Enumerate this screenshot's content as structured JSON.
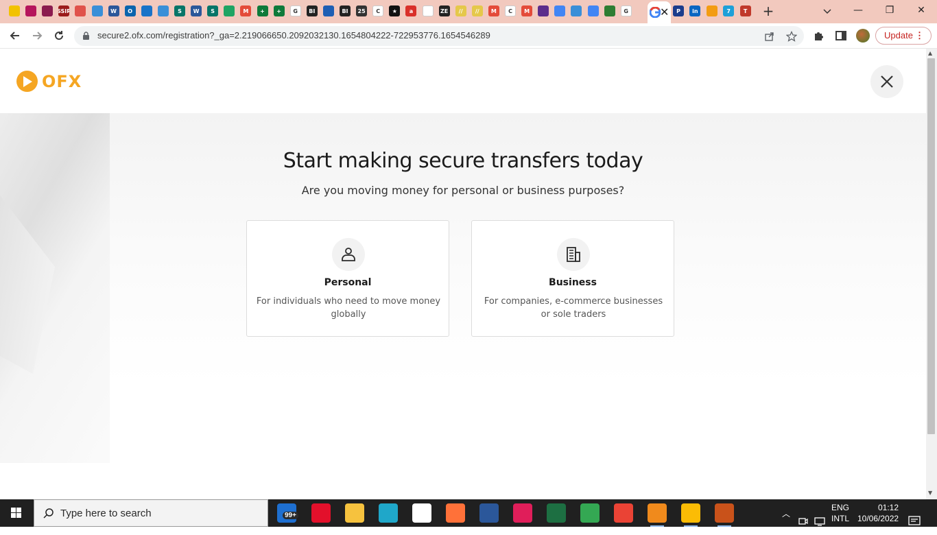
{
  "browser": {
    "tabs": [
      {
        "icon": "yellow-circle-icon",
        "color": "#f2c200",
        "glyph": ""
      },
      {
        "icon": "pink-bolt-icon",
        "color": "#b5155c",
        "glyph": ""
      },
      {
        "icon": "pink-bolt-icon",
        "color": "#8b1c4f",
        "glyph": ""
      },
      {
        "icon": "ssir-icon",
        "color": "#9b1b1b",
        "glyph": "SSIR"
      },
      {
        "icon": "colorful-circle-icon",
        "color": "#e0524b",
        "glyph": ""
      },
      {
        "icon": "chrome-blue-icon",
        "color": "#3a8fd8",
        "glyph": ""
      },
      {
        "icon": "word-icon",
        "color": "#2b579a",
        "glyph": "W"
      },
      {
        "icon": "outlook-icon",
        "color": "#0a64ad",
        "glyph": "O"
      },
      {
        "icon": "onedrive-icon",
        "color": "#1a73c8",
        "glyph": ""
      },
      {
        "icon": "chrome-blue-icon",
        "color": "#3a8fd8",
        "glyph": ""
      },
      {
        "icon": "sway-icon",
        "color": "#077568",
        "glyph": "S"
      },
      {
        "icon": "word-icon",
        "color": "#2b579a",
        "glyph": "W"
      },
      {
        "icon": "sway-icon",
        "color": "#077568",
        "glyph": "S"
      },
      {
        "icon": "drive-icon",
        "color": "#1fa463",
        "glyph": ""
      },
      {
        "icon": "gmail-icon",
        "color": "#e44b3a",
        "glyph": "M"
      },
      {
        "icon": "plus-green-icon",
        "color": "#0e7a3a",
        "glyph": "+"
      },
      {
        "icon": "plus-green-icon",
        "color": "#0e7a3a",
        "glyph": "+"
      },
      {
        "icon": "google-icon",
        "color": "#ffffff",
        "glyph": "G"
      },
      {
        "icon": "bi-icon",
        "color": "#222222",
        "glyph": "BI"
      },
      {
        "icon": "blue-wave-icon",
        "color": "#1e5fb4",
        "glyph": ""
      },
      {
        "icon": "bi-icon",
        "color": "#222222",
        "glyph": "BI"
      },
      {
        "icon": "25-icon",
        "color": "#333333",
        "glyph": "25"
      },
      {
        "icon": "c-icon",
        "color": "#ffffff",
        "glyph": "C"
      },
      {
        "icon": "star-icon",
        "color": "#111111",
        "glyph": "★"
      },
      {
        "icon": "red-a-icon",
        "color": "#d9302a",
        "glyph": "a"
      },
      {
        "icon": "hand-icon",
        "color": "#ffffff",
        "glyph": ""
      },
      {
        "icon": "zen-icon",
        "color": "#222222",
        "glyph": "ZE"
      },
      {
        "icon": "yellow-slash-icon",
        "color": "#e5c84a",
        "glyph": "//"
      },
      {
        "icon": "yellow-slash-icon",
        "color": "#e5c84a",
        "glyph": "//"
      },
      {
        "icon": "gmail-icon",
        "color": "#e44b3a",
        "glyph": "M"
      },
      {
        "icon": "c-icon",
        "color": "#ffffff",
        "glyph": "C"
      },
      {
        "icon": "gmail-icon",
        "color": "#e44b3a",
        "glyph": "M"
      },
      {
        "icon": "trello-icon",
        "color": "#5b2d8c",
        "glyph": ""
      },
      {
        "icon": "docs-icon",
        "color": "#4285f4",
        "glyph": ""
      },
      {
        "icon": "chrome-blue-icon",
        "color": "#3a8fd8",
        "glyph": ""
      },
      {
        "icon": "docs-icon",
        "color": "#4285f4",
        "glyph": ""
      },
      {
        "icon": "qr-icon",
        "color": "#2e7d32",
        "glyph": ""
      },
      {
        "icon": "google-icon",
        "color": "#ffffff",
        "glyph": "G"
      }
    ],
    "tabs_after": [
      {
        "icon": "paypal-icon",
        "color": "#1b3c8c",
        "glyph": "P"
      },
      {
        "icon": "linkedin-icon",
        "color": "#0a66c2",
        "glyph": "in"
      },
      {
        "icon": "orange-circle-icon",
        "color": "#f39c12",
        "glyph": ""
      },
      {
        "icon": "flag-icon",
        "color": "#1ea0d8",
        "glyph": "7"
      },
      {
        "icon": "t-icon",
        "color": "#c0392b",
        "glyph": "T"
      }
    ],
    "new_tab_label": "+",
    "url": "secure2.ofx.com/registration?_ga=2.219066650.2092032130.1654804222-722953776.1654546289",
    "update_label": "Update"
  },
  "page": {
    "brand": "OFX",
    "title": "Start making secure transfers today",
    "subtitle": "Are you moving money for personal or business purposes?",
    "cards": [
      {
        "title": "Personal",
        "description": "For individuals who need to move money globally"
      },
      {
        "title": "Business",
        "description": "For companies, e-commerce businesses or sole traders"
      }
    ]
  },
  "taskbar": {
    "search_placeholder": "Type here to search",
    "mail_badge": "99+",
    "apps": [
      {
        "icon": "mail-icon",
        "color": "#1e6fd0"
      },
      {
        "icon": "opera-icon",
        "color": "#e3102b"
      },
      {
        "icon": "file-explorer-icon",
        "color": "#f6c23e"
      },
      {
        "icon": "edge-icon",
        "color": "#1fa7c9"
      },
      {
        "icon": "settings-icon",
        "color": "#ffffff"
      },
      {
        "icon": "firefox-icon",
        "color": "#ff7139"
      },
      {
        "icon": "word-icon",
        "color": "#2b579a"
      },
      {
        "icon": "slack-icon",
        "color": "#e01e5a"
      },
      {
        "icon": "excel-icon",
        "color": "#1d6f42"
      },
      {
        "icon": "chrome-icon",
        "color": "#34a853"
      },
      {
        "icon": "chrome-icon",
        "color": "#ea4335"
      },
      {
        "icon": "vlc-icon",
        "color": "#f08a1c"
      },
      {
        "icon": "chrome-icon",
        "color": "#fbbc05"
      },
      {
        "icon": "office-icon",
        "color": "#eb3c00"
      }
    ],
    "lang_line1": "ENG",
    "lang_line2": "INTL",
    "time": "01:12",
    "date": "10/06/2022"
  }
}
